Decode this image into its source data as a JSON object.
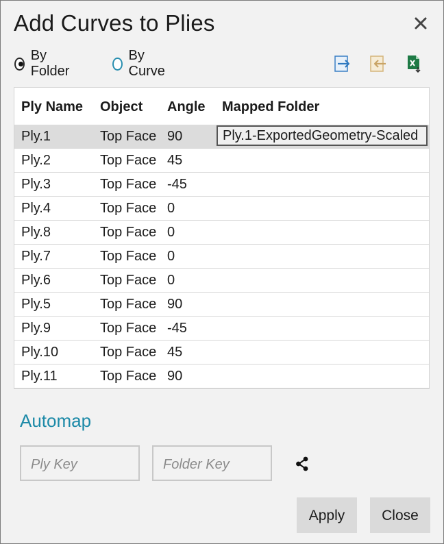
{
  "dialog": {
    "title": "Add Curves to Plies"
  },
  "mode": {
    "by_folder_label": "By Folder",
    "by_curve_label": "By Curve",
    "selected": "By Folder"
  },
  "toolbar": {
    "icons": [
      "export-icon",
      "import-icon",
      "excel-export-icon"
    ]
  },
  "table": {
    "headers": [
      "Ply Name",
      "Object",
      "Angle",
      "Mapped Folder"
    ],
    "rows": [
      {
        "name": "Ply.1",
        "object": "Top Face",
        "angle": "90",
        "mapped": "Ply.1-ExportedGeometry-Scaled"
      },
      {
        "name": "Ply.2",
        "object": "Top Face",
        "angle": "45",
        "mapped": ""
      },
      {
        "name": "Ply.3",
        "object": "Top Face",
        "angle": "-45",
        "mapped": ""
      },
      {
        "name": "Ply.4",
        "object": "Top Face",
        "angle": "0",
        "mapped": ""
      },
      {
        "name": "Ply.8",
        "object": "Top Face",
        "angle": "0",
        "mapped": ""
      },
      {
        "name": "Ply.7",
        "object": "Top Face",
        "angle": "0",
        "mapped": ""
      },
      {
        "name": "Ply.6",
        "object": "Top Face",
        "angle": "0",
        "mapped": ""
      },
      {
        "name": "Ply.5",
        "object": "Top Face",
        "angle": "90",
        "mapped": ""
      },
      {
        "name": "Ply.9",
        "object": "Top Face",
        "angle": "-45",
        "mapped": ""
      },
      {
        "name": "Ply.10",
        "object": "Top Face",
        "angle": "45",
        "mapped": ""
      },
      {
        "name": "Ply.11",
        "object": "Top Face",
        "angle": "90",
        "mapped": ""
      }
    ]
  },
  "automap": {
    "heading": "Automap",
    "ply_key_placeholder": "Ply Key",
    "ply_key_value": "",
    "folder_key_placeholder": "Folder Key",
    "folder_key_value": ""
  },
  "buttons": {
    "apply": "Apply",
    "close": "Close"
  },
  "colors": {
    "accent": "#1d8aa8",
    "dialog_bg": "#f2f2f2",
    "selected_row": "#dcdcdc",
    "button_bg": "#dadada"
  }
}
